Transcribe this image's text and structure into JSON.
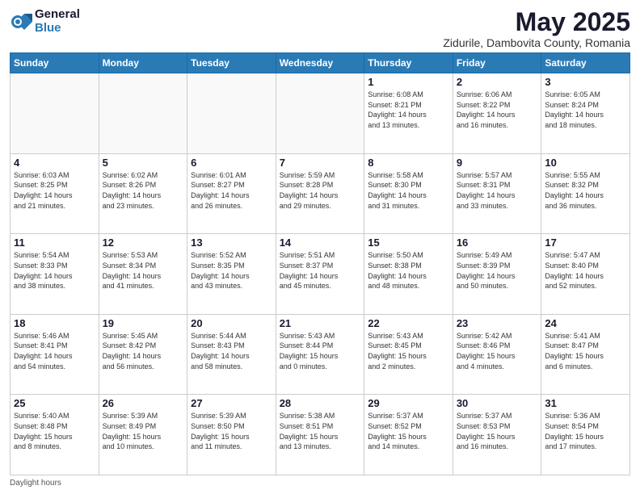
{
  "logo": {
    "general": "General",
    "blue": "Blue"
  },
  "header": {
    "month": "May 2025",
    "location": "Zidurile, Dambovita County, Romania"
  },
  "days_of_week": [
    "Sunday",
    "Monday",
    "Tuesday",
    "Wednesday",
    "Thursday",
    "Friday",
    "Saturday"
  ],
  "footer": {
    "note": "Daylight hours"
  },
  "weeks": [
    [
      {
        "day": "",
        "info": ""
      },
      {
        "day": "",
        "info": ""
      },
      {
        "day": "",
        "info": ""
      },
      {
        "day": "",
        "info": ""
      },
      {
        "day": "1",
        "info": "Sunrise: 6:08 AM\nSunset: 8:21 PM\nDaylight: 14 hours\nand 13 minutes."
      },
      {
        "day": "2",
        "info": "Sunrise: 6:06 AM\nSunset: 8:22 PM\nDaylight: 14 hours\nand 16 minutes."
      },
      {
        "day": "3",
        "info": "Sunrise: 6:05 AM\nSunset: 8:24 PM\nDaylight: 14 hours\nand 18 minutes."
      }
    ],
    [
      {
        "day": "4",
        "info": "Sunrise: 6:03 AM\nSunset: 8:25 PM\nDaylight: 14 hours\nand 21 minutes."
      },
      {
        "day": "5",
        "info": "Sunrise: 6:02 AM\nSunset: 8:26 PM\nDaylight: 14 hours\nand 23 minutes."
      },
      {
        "day": "6",
        "info": "Sunrise: 6:01 AM\nSunset: 8:27 PM\nDaylight: 14 hours\nand 26 minutes."
      },
      {
        "day": "7",
        "info": "Sunrise: 5:59 AM\nSunset: 8:28 PM\nDaylight: 14 hours\nand 29 minutes."
      },
      {
        "day": "8",
        "info": "Sunrise: 5:58 AM\nSunset: 8:30 PM\nDaylight: 14 hours\nand 31 minutes."
      },
      {
        "day": "9",
        "info": "Sunrise: 5:57 AM\nSunset: 8:31 PM\nDaylight: 14 hours\nand 33 minutes."
      },
      {
        "day": "10",
        "info": "Sunrise: 5:55 AM\nSunset: 8:32 PM\nDaylight: 14 hours\nand 36 minutes."
      }
    ],
    [
      {
        "day": "11",
        "info": "Sunrise: 5:54 AM\nSunset: 8:33 PM\nDaylight: 14 hours\nand 38 minutes."
      },
      {
        "day": "12",
        "info": "Sunrise: 5:53 AM\nSunset: 8:34 PM\nDaylight: 14 hours\nand 41 minutes."
      },
      {
        "day": "13",
        "info": "Sunrise: 5:52 AM\nSunset: 8:35 PM\nDaylight: 14 hours\nand 43 minutes."
      },
      {
        "day": "14",
        "info": "Sunrise: 5:51 AM\nSunset: 8:37 PM\nDaylight: 14 hours\nand 45 minutes."
      },
      {
        "day": "15",
        "info": "Sunrise: 5:50 AM\nSunset: 8:38 PM\nDaylight: 14 hours\nand 48 minutes."
      },
      {
        "day": "16",
        "info": "Sunrise: 5:49 AM\nSunset: 8:39 PM\nDaylight: 14 hours\nand 50 minutes."
      },
      {
        "day": "17",
        "info": "Sunrise: 5:47 AM\nSunset: 8:40 PM\nDaylight: 14 hours\nand 52 minutes."
      }
    ],
    [
      {
        "day": "18",
        "info": "Sunrise: 5:46 AM\nSunset: 8:41 PM\nDaylight: 14 hours\nand 54 minutes."
      },
      {
        "day": "19",
        "info": "Sunrise: 5:45 AM\nSunset: 8:42 PM\nDaylight: 14 hours\nand 56 minutes."
      },
      {
        "day": "20",
        "info": "Sunrise: 5:44 AM\nSunset: 8:43 PM\nDaylight: 14 hours\nand 58 minutes."
      },
      {
        "day": "21",
        "info": "Sunrise: 5:43 AM\nSunset: 8:44 PM\nDaylight: 15 hours\nand 0 minutes."
      },
      {
        "day": "22",
        "info": "Sunrise: 5:43 AM\nSunset: 8:45 PM\nDaylight: 15 hours\nand 2 minutes."
      },
      {
        "day": "23",
        "info": "Sunrise: 5:42 AM\nSunset: 8:46 PM\nDaylight: 15 hours\nand 4 minutes."
      },
      {
        "day": "24",
        "info": "Sunrise: 5:41 AM\nSunset: 8:47 PM\nDaylight: 15 hours\nand 6 minutes."
      }
    ],
    [
      {
        "day": "25",
        "info": "Sunrise: 5:40 AM\nSunset: 8:48 PM\nDaylight: 15 hours\nand 8 minutes."
      },
      {
        "day": "26",
        "info": "Sunrise: 5:39 AM\nSunset: 8:49 PM\nDaylight: 15 hours\nand 10 minutes."
      },
      {
        "day": "27",
        "info": "Sunrise: 5:39 AM\nSunset: 8:50 PM\nDaylight: 15 hours\nand 11 minutes."
      },
      {
        "day": "28",
        "info": "Sunrise: 5:38 AM\nSunset: 8:51 PM\nDaylight: 15 hours\nand 13 minutes."
      },
      {
        "day": "29",
        "info": "Sunrise: 5:37 AM\nSunset: 8:52 PM\nDaylight: 15 hours\nand 14 minutes."
      },
      {
        "day": "30",
        "info": "Sunrise: 5:37 AM\nSunset: 8:53 PM\nDaylight: 15 hours\nand 16 minutes."
      },
      {
        "day": "31",
        "info": "Sunrise: 5:36 AM\nSunset: 8:54 PM\nDaylight: 15 hours\nand 17 minutes."
      }
    ]
  ]
}
